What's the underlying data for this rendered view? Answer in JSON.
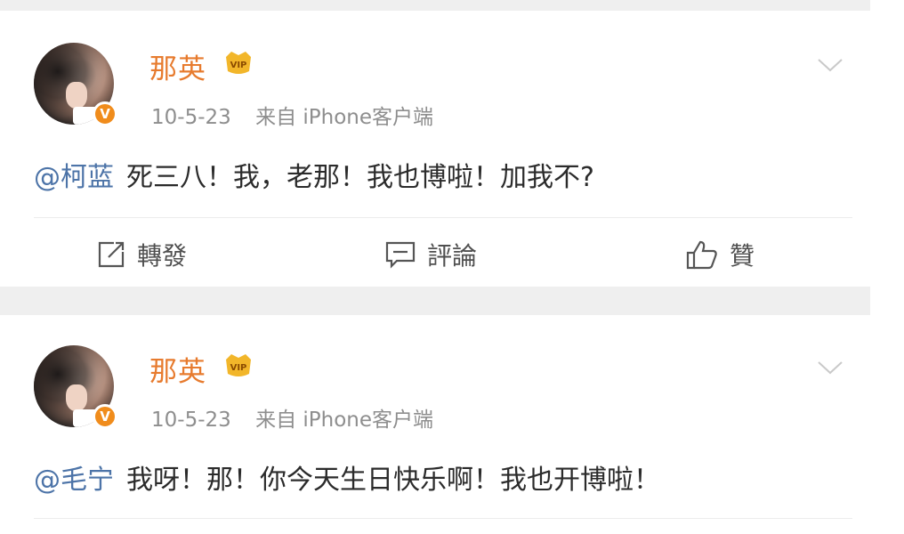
{
  "posts": [
    {
      "username": "那英",
      "date": "10-5-23",
      "source": "来自 iPhone客户端",
      "mention": "@柯蓝",
      "text": "死三八！我，老那！我也博啦！加我不?",
      "actions": {
        "repost": "轉發",
        "comment": "評論",
        "like": "贊"
      }
    },
    {
      "username": "那英",
      "date": "10-5-23",
      "source": "来自 iPhone客户端",
      "mention": "@毛宁",
      "text": "我呀！那！你今天生日快乐啊！我也开博啦！"
    }
  ],
  "badges": {
    "verified": "V",
    "vip": "VIP"
  },
  "colors": {
    "username": "#e77b2e",
    "mention": "#4d74a8",
    "verified_badge": "#f08c1c",
    "vip_badge": "#f2b62a",
    "separator": "#efefef"
  },
  "icons": {
    "repost": "repost-icon",
    "comment": "comment-icon",
    "like": "thumbs-up-icon",
    "menu": "chevron-down-icon"
  }
}
